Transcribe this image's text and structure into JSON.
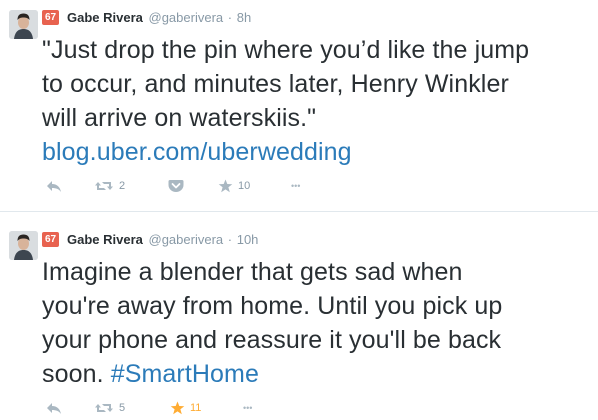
{
  "tweets": [
    {
      "badge": "67",
      "fullname": "Gabe Rivera",
      "username": "@gaberivera",
      "separator": "·",
      "time": "8h",
      "text_lines": [
        "\"Just drop the pin where you’d like the jump",
        "to occur, and minutes later, Henry Winkler",
        "will arrive on waterskiis.\""
      ],
      "link": "blog.uber.com/uberwedding",
      "retweet_count": "2",
      "favorite_count": "10",
      "more_label": "•••",
      "icons": [
        "reply-icon",
        "retweet-icon",
        "pocket-icon",
        "star-icon",
        "more-icon"
      ]
    },
    {
      "badge": "67",
      "fullname": "Gabe Rivera",
      "username": "@gaberivera",
      "separator": "·",
      "time": "10h",
      "text_lines": [
        "Imagine a blender that gets sad when",
        "you're away from home. Until you pick up",
        "your phone and reassure it you'll be back"
      ],
      "last_line_prefix": "soon. ",
      "hashtag": "#SmartHome",
      "retweet_count": "5",
      "favorite_count": "11",
      "more_label": "•••",
      "favorited": true,
      "icons": [
        "reply-icon",
        "retweet-icon",
        "star-icon",
        "more-icon"
      ]
    }
  ],
  "colors": {
    "badge": "#e8624f",
    "link": "#2b7bb9",
    "muted": "#8899a6",
    "icon": "#aab8c2",
    "favorite_active": "#ffac33",
    "divider": "#e1e8ed"
  }
}
